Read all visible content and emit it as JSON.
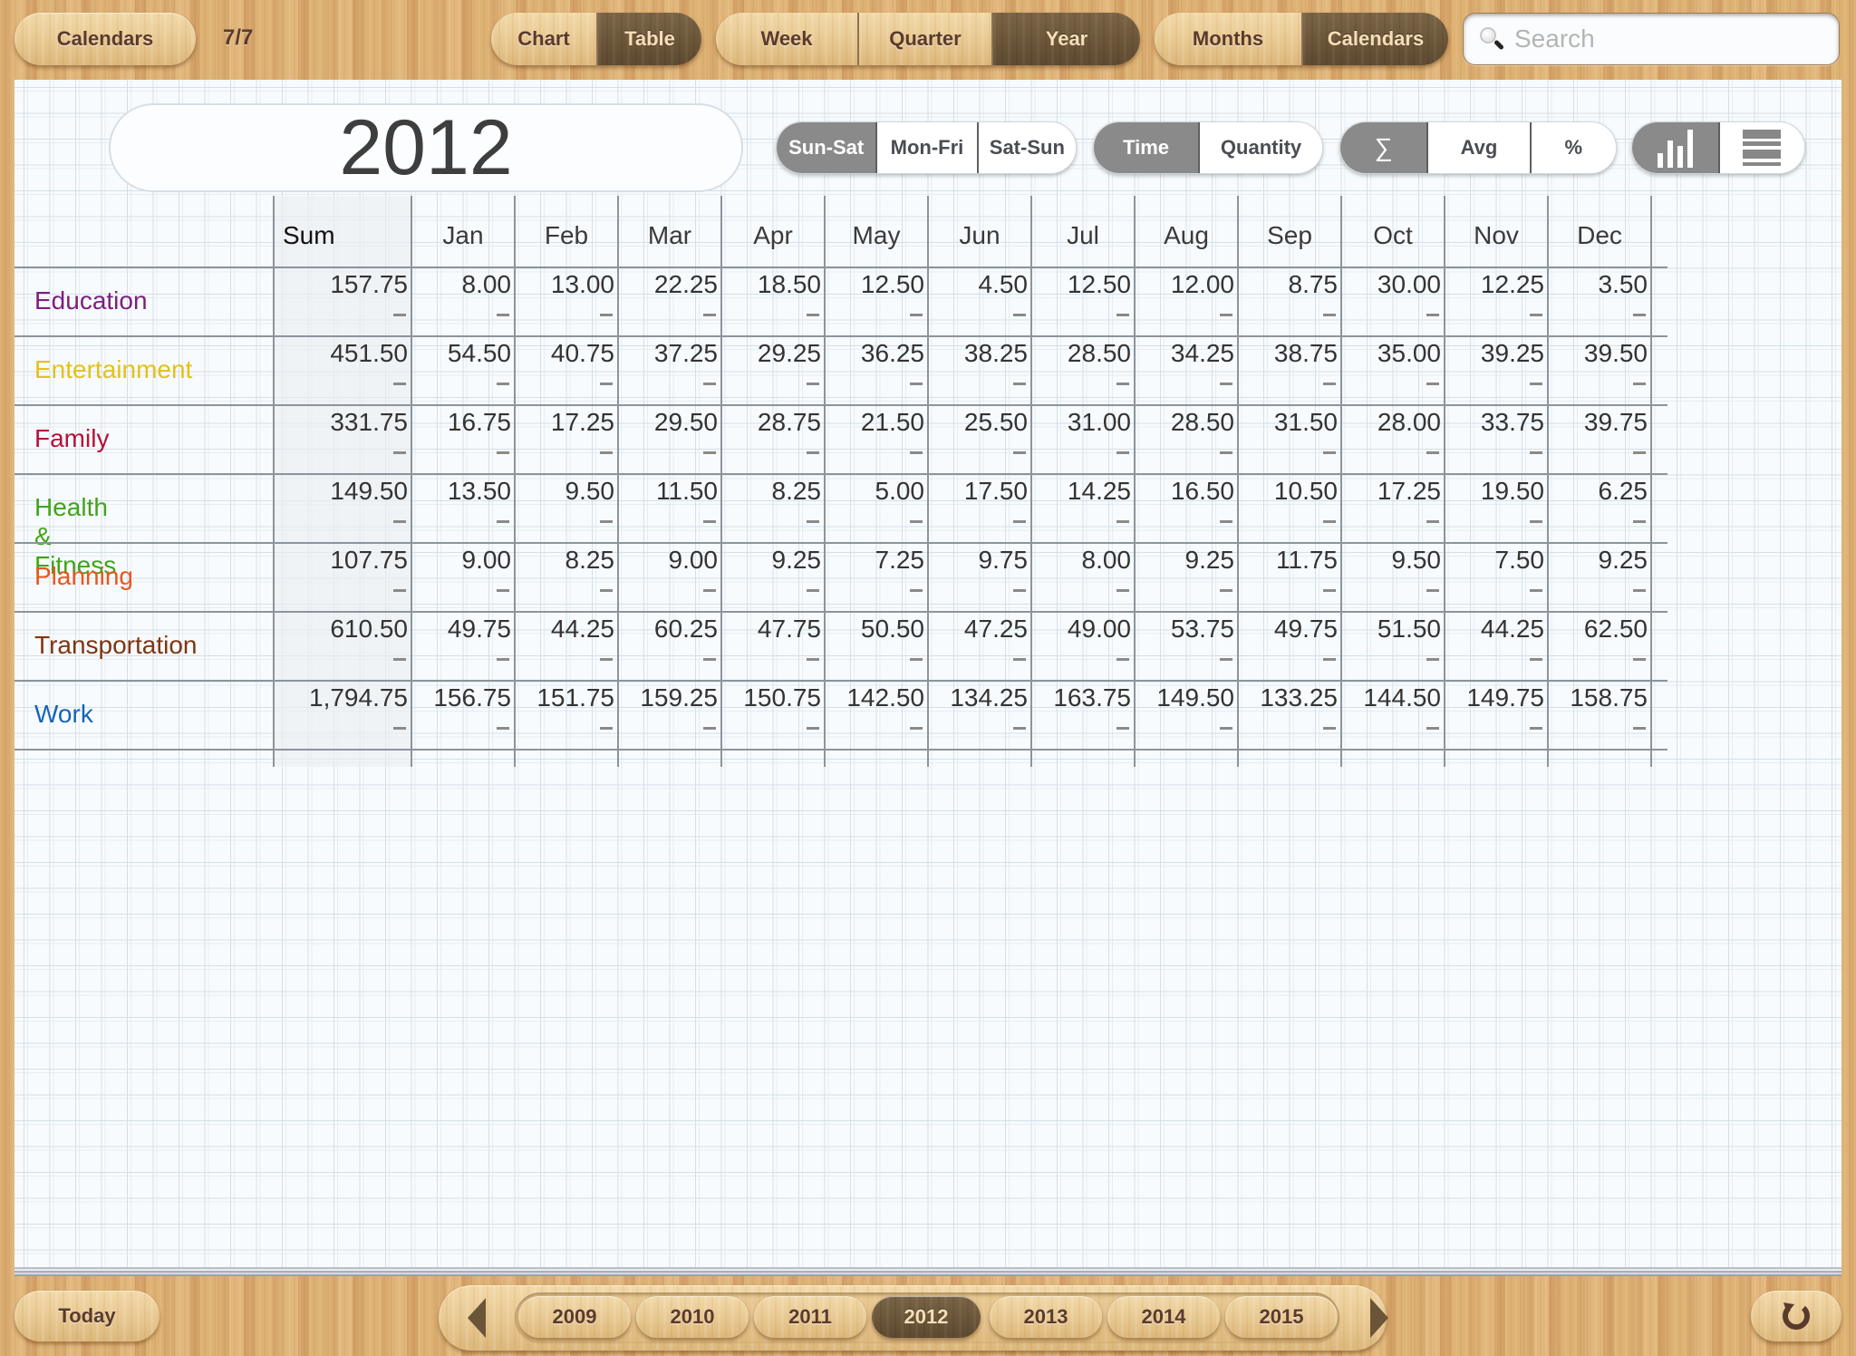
{
  "toolbar": {
    "calendars_button": "Calendars",
    "calendar_count": "7/7",
    "view_mode": {
      "options": [
        "Chart",
        "Table"
      ],
      "selected": "Table"
    },
    "period": {
      "options": [
        "Week",
        "Quarter",
        "Year"
      ],
      "selected": "Year"
    },
    "grouping": {
      "options": [
        "Months",
        "Calendars"
      ],
      "selected": "Calendars"
    },
    "search": {
      "placeholder": "Search",
      "value": "",
      "icon": "search-icon"
    }
  },
  "controls": {
    "year_title": "2012",
    "days_filter": {
      "options": [
        "Sun-Sat",
        "Mon-Fri",
        "Sat-Sun"
      ],
      "selected": "Sun-Sat"
    },
    "measure": {
      "options": [
        "Time",
        "Quantity"
      ],
      "selected": "Time"
    },
    "aggregate": {
      "options": [
        "∑",
        "Avg",
        "%"
      ],
      "selected": "∑"
    },
    "display": {
      "options": [
        "bar-chart-icon",
        "list-icon"
      ],
      "selected": "bar-chart-icon"
    }
  },
  "table": {
    "columns": [
      "Sum",
      "Jan",
      "Feb",
      "Mar",
      "Apr",
      "May",
      "Jun",
      "Jul",
      "Aug",
      "Sep",
      "Oct",
      "Nov",
      "Dec"
    ],
    "secondary_placeholder": "–",
    "rows": [
      {
        "category": "Education",
        "color": "#7b1f7e",
        "values": [
          "157.75",
          "8.00",
          "13.00",
          "22.25",
          "18.50",
          "12.50",
          "4.50",
          "12.50",
          "12.00",
          "8.75",
          "30.00",
          "12.25",
          "3.50"
        ]
      },
      {
        "category": "Entertainment",
        "color": "#e2c21a",
        "values": [
          "451.50",
          "54.50",
          "40.75",
          "37.25",
          "29.25",
          "36.25",
          "38.25",
          "28.50",
          "34.25",
          "38.75",
          "35.00",
          "39.25",
          "39.50"
        ]
      },
      {
        "category": "Family",
        "color": "#b3123a",
        "values": [
          "331.75",
          "16.75",
          "17.25",
          "29.50",
          "28.75",
          "21.50",
          "25.50",
          "31.00",
          "28.50",
          "31.50",
          "28.00",
          "33.75",
          "39.75"
        ]
      },
      {
        "category": "Health & Fitness",
        "color": "#3fa51a",
        "values": [
          "149.50",
          "13.50",
          "9.50",
          "11.50",
          "8.25",
          "5.00",
          "17.50",
          "14.25",
          "16.50",
          "10.50",
          "17.25",
          "19.50",
          "6.25"
        ]
      },
      {
        "category": "Planning",
        "color": "#e8561e",
        "values": [
          "107.75",
          "9.00",
          "8.25",
          "9.00",
          "9.25",
          "7.25",
          "9.75",
          "8.00",
          "9.25",
          "11.75",
          "9.50",
          "7.50",
          "9.25"
        ]
      },
      {
        "category": "Transportation",
        "color": "#7f3510",
        "values": [
          "610.50",
          "49.75",
          "44.25",
          "60.25",
          "47.75",
          "50.50",
          "47.25",
          "49.00",
          "53.75",
          "49.75",
          "51.50",
          "44.25",
          "62.50"
        ]
      },
      {
        "category": "Work",
        "color": "#1565b8",
        "values": [
          "1,794.75",
          "156.75",
          "151.75",
          "159.25",
          "150.75",
          "142.50",
          "134.25",
          "163.75",
          "149.50",
          "133.25",
          "144.50",
          "149.75",
          "158.75"
        ]
      }
    ]
  },
  "bottom_bar": {
    "today_button": "Today",
    "years": [
      "2009",
      "2010",
      "2011",
      "2012",
      "2013",
      "2014",
      "2015"
    ],
    "selected_year": "2012",
    "prev_icon": "previous-arrow-icon",
    "next_icon": "next-arrow-icon",
    "refresh_icon": "refresh-icon"
  }
}
